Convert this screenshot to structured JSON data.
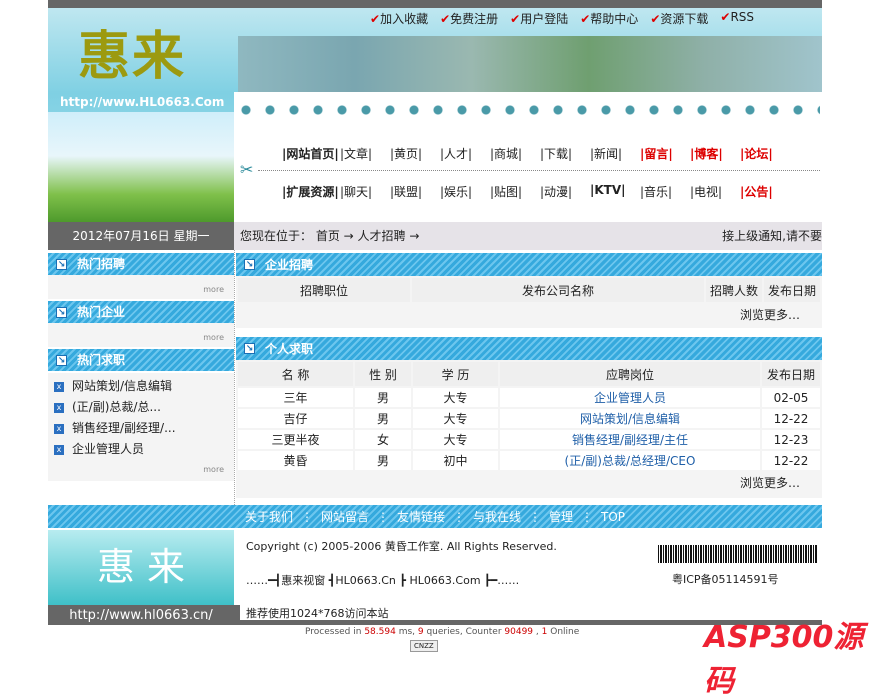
{
  "top_links": [
    "加入收藏",
    "免费注册",
    "用户登陆",
    "帮助中心",
    "资源下载",
    "RSS"
  ],
  "logo": {
    "text": "惠来",
    "url": "http://www.HL0663.Com"
  },
  "nav_row1": [
    {
      "label": "|网站首页|",
      "bold": true
    },
    {
      "label": "|文章|"
    },
    {
      "label": "|黄页|"
    },
    {
      "label": "|人才|"
    },
    {
      "label": "|商城|"
    },
    {
      "label": "|下载|"
    },
    {
      "label": "|新闻|"
    },
    {
      "label": "|留言|",
      "red": true
    },
    {
      "label": "|博客|",
      "red": true
    },
    {
      "label": "|论坛|",
      "red": true
    }
  ],
  "nav_row2": [
    {
      "label": "|扩展资源|",
      "bold": true
    },
    {
      "label": "|聊天|"
    },
    {
      "label": "|联盟|"
    },
    {
      "label": "|娱乐|"
    },
    {
      "label": "|贴图|"
    },
    {
      "label": "|动漫|"
    },
    {
      "label": "|KTV|",
      "bold": true
    },
    {
      "label": "|音乐|"
    },
    {
      "label": "|电视|"
    },
    {
      "label": "|公告|",
      "red": true
    }
  ],
  "date": "2012年07月16日 星期一",
  "breadcrumb": "您现在位于： 首页 → 人才招聘 →",
  "notice": "接上级通知,请不要",
  "sidebar": {
    "hot_jobs": "热门招聘",
    "hot_companies": "热门企业",
    "hot_seeking": "热门求职",
    "more": "more",
    "seeking_items": [
      "网站策划/信息编辑",
      "(正/副)总裁/总...",
      "销售经理/副经理/...",
      "企业管理人员"
    ]
  },
  "company": {
    "title": "企业招聘",
    "headers": [
      "招聘职位",
      "发布公司名称",
      "招聘人数",
      "发布日期"
    ],
    "more": "浏览更多…"
  },
  "personal": {
    "title": "个人求职",
    "headers": [
      "名 称",
      "性 别",
      "学 历",
      "应聘岗位",
      "发布日期"
    ],
    "rows": [
      [
        "三年",
        "男",
        "大专",
        "企业管理人员",
        "02-05"
      ],
      [
        "吉仔",
        "男",
        "大专",
        "网站策划/信息编辑",
        "12-22"
      ],
      [
        "三更半夜",
        "女",
        "大专",
        "销售经理/副经理/主任",
        "12-23"
      ],
      [
        "黄昏",
        "男",
        "初中",
        "(正/副)总裁/总经理/CEO",
        "12-22"
      ]
    ],
    "more": "浏览更多…"
  },
  "footer_links": [
    "关于我们",
    "网站留言",
    "友情链接",
    "与我在线",
    "管理",
    "TOP"
  ],
  "footer": {
    "logo": "惠 来",
    "url": "http://www.hl0663.cn/",
    "copyright": "Copyright (c) 2005-2006 黄昏工作室. All Rights Reserved.",
    "links": "……━┫惠来视窗 ┫HL0663.Cn ┣ HL0663.Com ┣━……",
    "icp": "粤ICP备05114591号",
    "recommend": "推荐使用1024*768访问本站"
  },
  "stats": {
    "pre": "Processed in ",
    "ms": "58.594",
    "mid1": " ms, ",
    "queries": "9",
    "mid2": " queries, Counter ",
    "counter": "90499",
    "mid3": " , ",
    "online": "1",
    "post": " Online"
  },
  "badge": "CNZZ",
  "watermark": "ASP300源码"
}
